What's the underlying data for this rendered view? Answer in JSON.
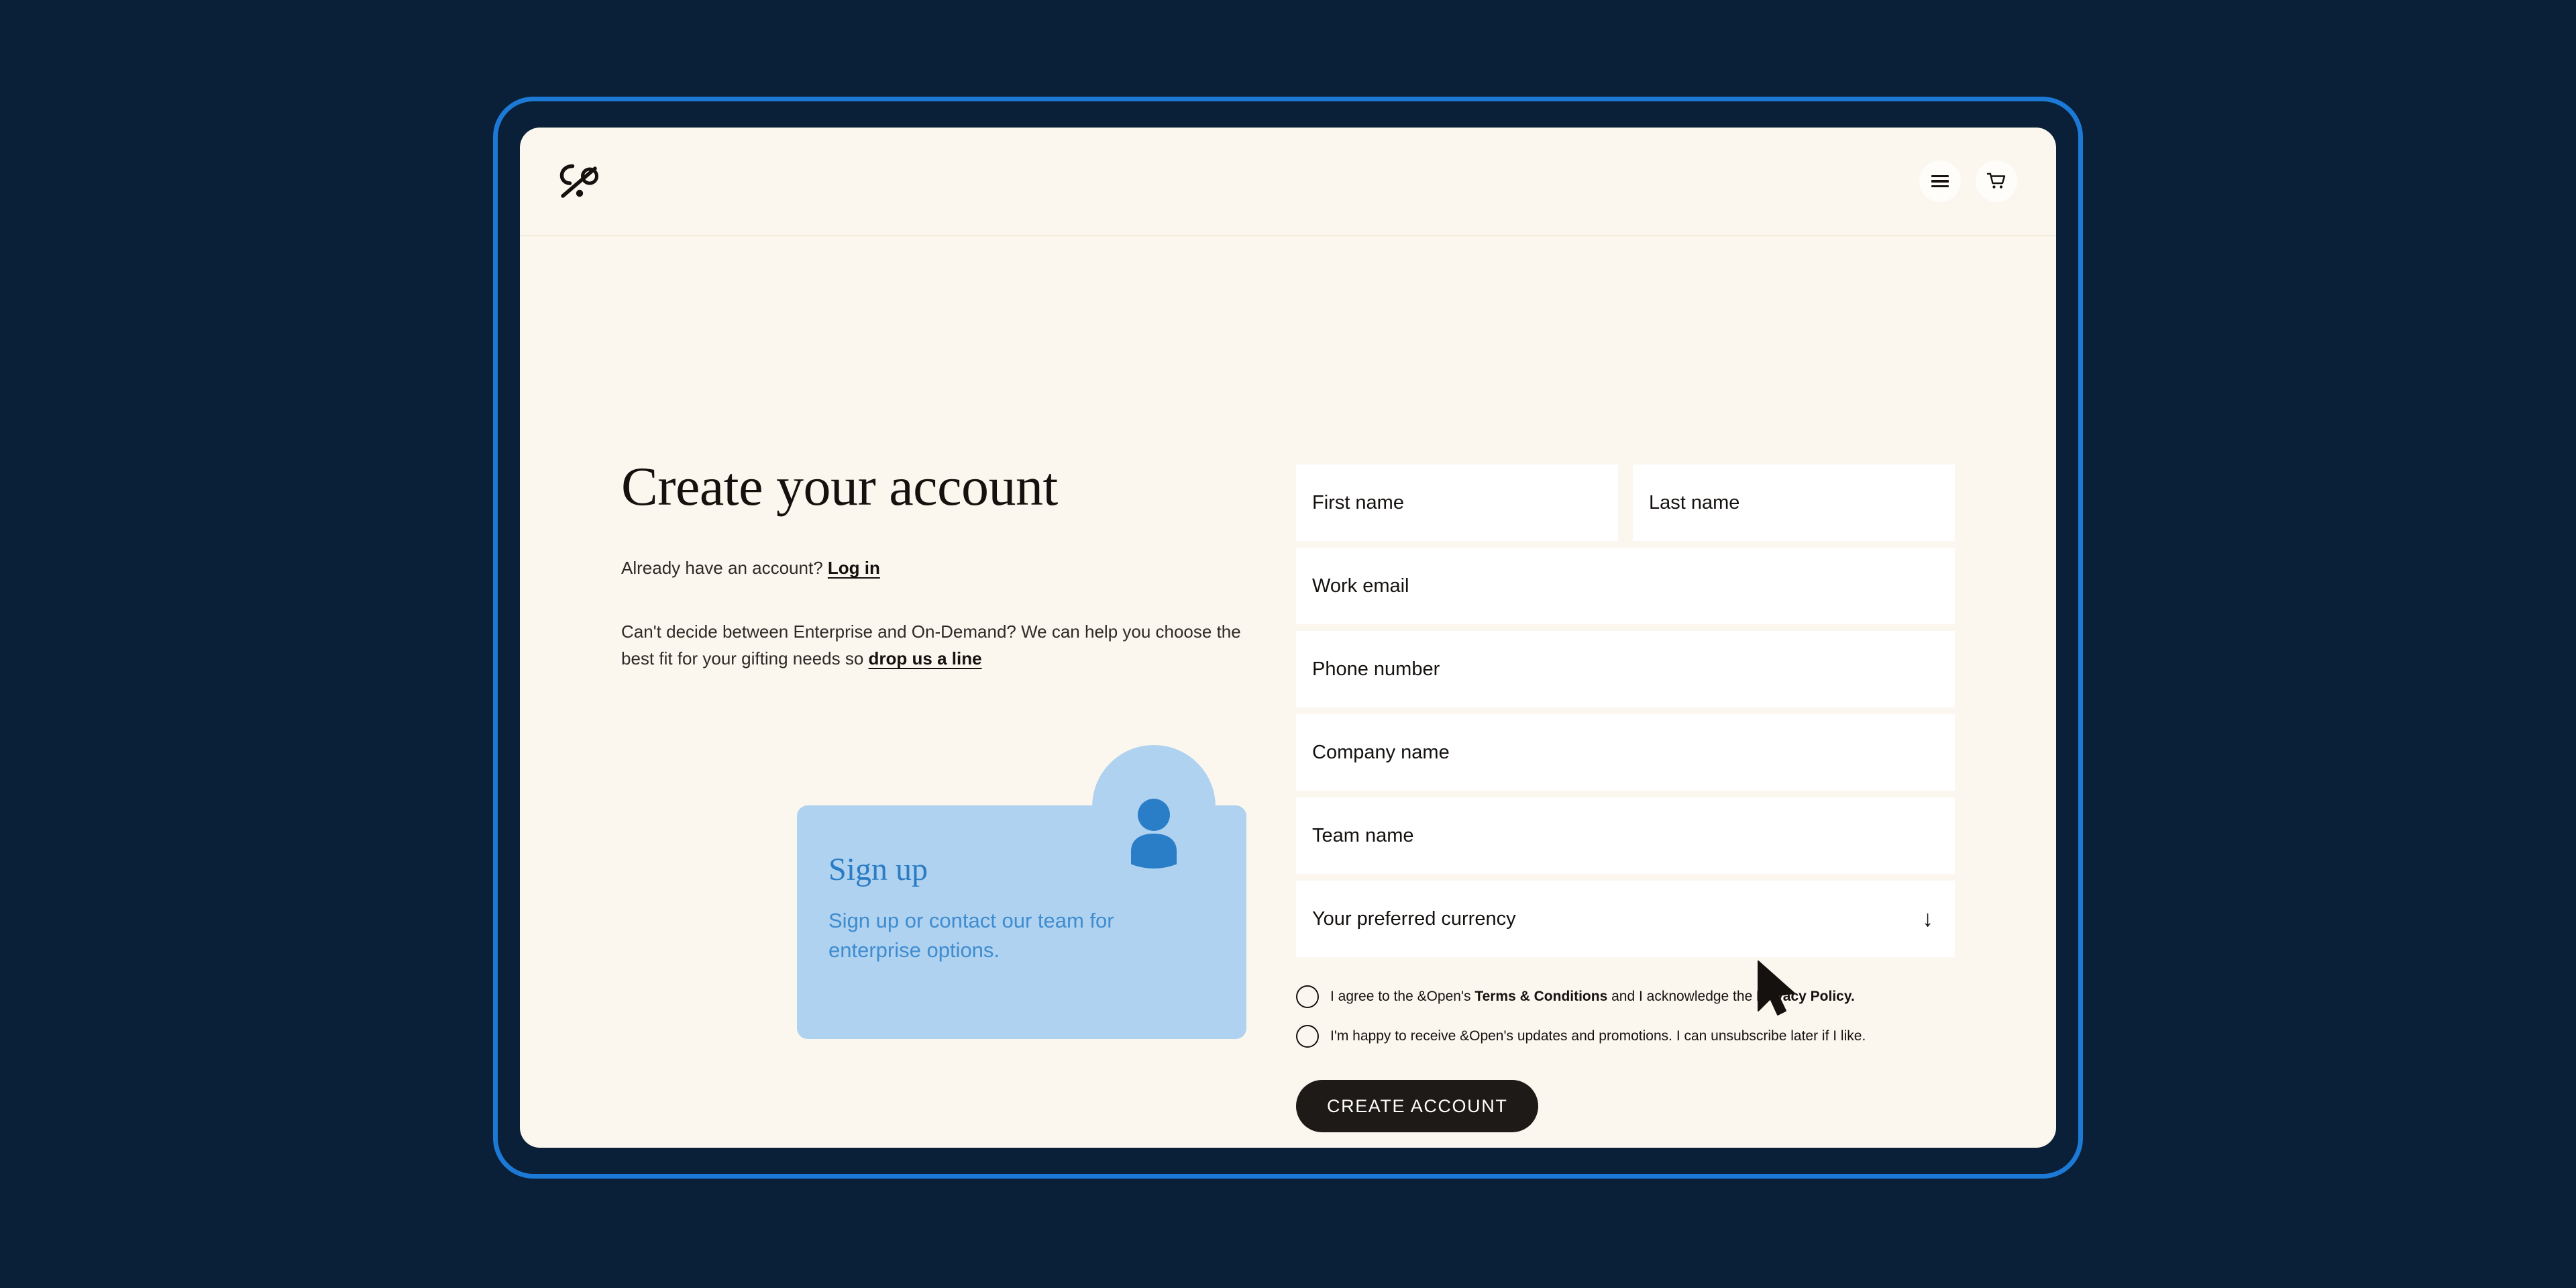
{
  "theme": {
    "backdrop": "#0a2038",
    "frame_border": "#1c7ad6",
    "page_background": "#fbf7ee",
    "field_background": "#ffffff",
    "callout_background": "#aed2ef",
    "callout_accent": "#2b7cc4",
    "button_background": "#1d1a18",
    "text_primary": "#14110f"
  },
  "header": {
    "logo_name": "and-open-logo",
    "menu_icon": "hamburger-menu-icon",
    "cart_icon": "shopping-cart-icon"
  },
  "intro": {
    "title": "Create your account",
    "login_prompt_prefix": "Already have an account? ",
    "login_link": "Log in",
    "helper_text_prefix": "Can't decide between Enterprise and On-Demand? We can help you choose the best fit for your gifting needs so ",
    "helper_link": "drop us a line"
  },
  "callout": {
    "avatar_icon": "user-avatar-icon",
    "title": "Sign up",
    "body": "Sign up or contact our team for enterprise options."
  },
  "form": {
    "fields": [
      {
        "label": "First name",
        "name": "first-name-field"
      },
      {
        "label": "Last name",
        "name": "last-name-field"
      },
      {
        "label": "Work email",
        "name": "work-email-field"
      },
      {
        "label": "Phone number",
        "name": "phone-number-field"
      },
      {
        "label": "Company name",
        "name": "company-name-field"
      },
      {
        "label": "Team name",
        "name": "team-name-field"
      }
    ],
    "currency_select": {
      "label": "Your preferred currency",
      "arrow_glyph": "↓"
    },
    "consents": [
      {
        "part1": "I agree to the &Open's ",
        "bold1": "Terms & Conditions",
        "part2": " and I acknowledge the ",
        "bold2": "Privacy Policy.",
        "checked": false
      },
      {
        "part1": "I'm happy to receive &Open's updates and promotions. I can unsubscribe later if I like.",
        "bold1": "",
        "part2": "",
        "bold2": "",
        "checked": false
      }
    ],
    "submit_label": "CREATE ACCOUNT"
  },
  "cursor": {
    "name": "mouse-pointer-cursor"
  }
}
